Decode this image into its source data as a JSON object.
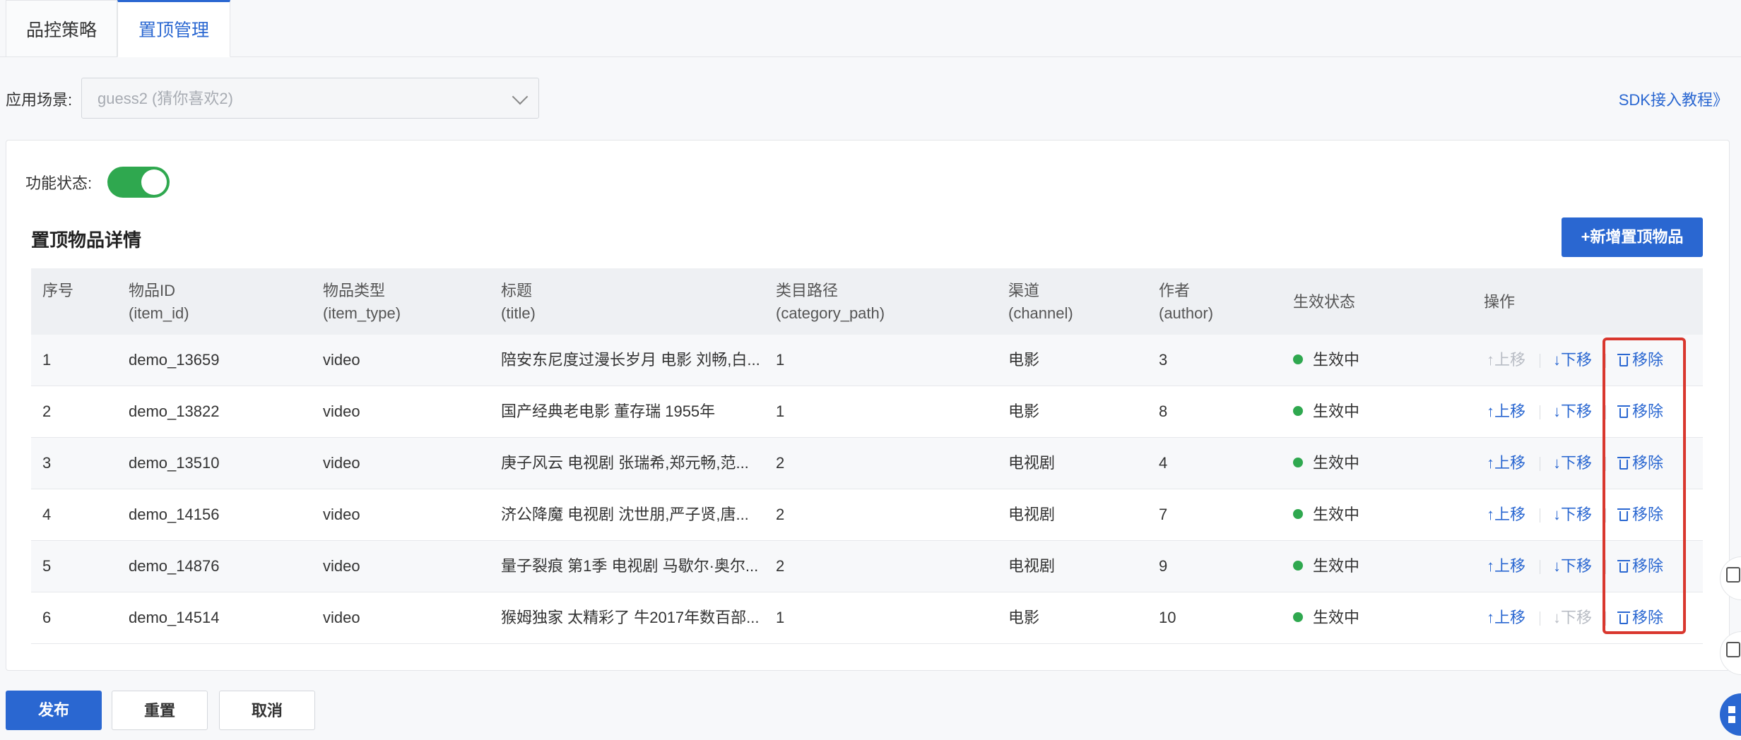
{
  "tabs": [
    {
      "label": "品控策略"
    },
    {
      "label": "置顶管理"
    }
  ],
  "scene": {
    "label": "应用场景:",
    "value": "guess2 (猜你喜欢2)"
  },
  "sdk_link": "SDK接入教程》",
  "func_status": {
    "label": "功能状态:",
    "enabled": true
  },
  "section": {
    "title": "置顶物品详情",
    "add_button": "+新增置顶物品"
  },
  "columns": [
    {
      "line1": "序号",
      "line2": ""
    },
    {
      "line1": "物品ID",
      "line2": "(item_id)"
    },
    {
      "line1": "物品类型",
      "line2": "(item_type)"
    },
    {
      "line1": "标题",
      "line2": "(title)"
    },
    {
      "line1": "类目路径",
      "line2": "(category_path)"
    },
    {
      "line1": "渠道",
      "line2": "(channel)"
    },
    {
      "line1": "作者",
      "line2": "(author)"
    },
    {
      "line1": "生效状态",
      "line2": ""
    },
    {
      "line1": "操作",
      "line2": ""
    }
  ],
  "rows": [
    {
      "seq": "1",
      "item_id": "demo_13659",
      "item_type": "video",
      "title": "陪安东尼度过漫长岁月 电影 刘畅,白...",
      "category_path": "1",
      "channel": "电影",
      "author": "3",
      "status": "生效中",
      "up_enabled": false,
      "down_enabled": true
    },
    {
      "seq": "2",
      "item_id": "demo_13822",
      "item_type": "video",
      "title": "国产经典老电影 董存瑞 1955年",
      "category_path": "1",
      "channel": "电影",
      "author": "8",
      "status": "生效中",
      "up_enabled": true,
      "down_enabled": true
    },
    {
      "seq": "3",
      "item_id": "demo_13510",
      "item_type": "video",
      "title": "庚子风云 电视剧 张瑞希,郑元畅,范...",
      "category_path": "2",
      "channel": "电视剧",
      "author": "4",
      "status": "生效中",
      "up_enabled": true,
      "down_enabled": true
    },
    {
      "seq": "4",
      "item_id": "demo_14156",
      "item_type": "video",
      "title": "济公降魔 电视剧 沈世朋,严子贤,唐...",
      "category_path": "2",
      "channel": "电视剧",
      "author": "7",
      "status": "生效中",
      "up_enabled": true,
      "down_enabled": true
    },
    {
      "seq": "5",
      "item_id": "demo_14876",
      "item_type": "video",
      "title": "量子裂痕 第1季 电视剧 马歇尔·奥尔...",
      "category_path": "2",
      "channel": "电视剧",
      "author": "9",
      "status": "生效中",
      "up_enabled": true,
      "down_enabled": true
    },
    {
      "seq": "6",
      "item_id": "demo_14514",
      "item_type": "video",
      "title": "猴姆独家 太精彩了 牛2017年数百部...",
      "category_path": "1",
      "channel": "电影",
      "author": "10",
      "status": "生效中",
      "up_enabled": true,
      "down_enabled": false
    }
  ],
  "actions": {
    "up": "↑上移",
    "down": "↓下移",
    "remove": "移除"
  },
  "footer": {
    "publish": "发布",
    "reset": "重置",
    "cancel": "取消"
  },
  "colors": {
    "primary": "#2a67d1",
    "success": "#2fa84f",
    "highlight": "#d9372e"
  }
}
